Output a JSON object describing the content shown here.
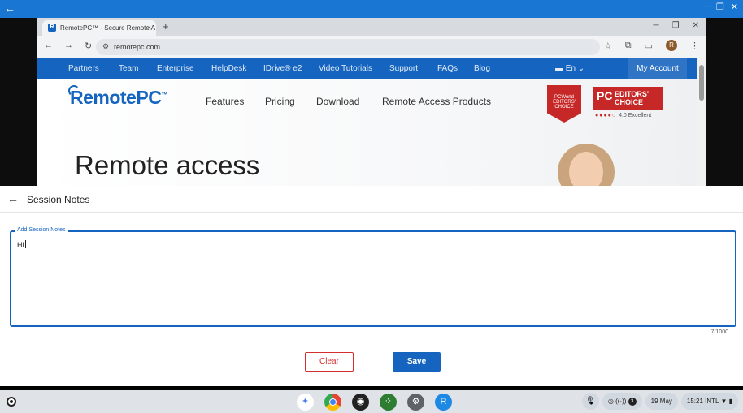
{
  "app_bar": {
    "back_icon": "arrow-left-icon",
    "window_buttons": [
      "minimize-icon",
      "restore-icon",
      "close-icon"
    ]
  },
  "browser": {
    "tab": {
      "title": "RemotePC™ - Secure Remote A",
      "close": "×"
    },
    "new_tab": "+",
    "window_controls": [
      "─",
      "❐",
      "✕"
    ],
    "url": "remotepc.com"
  },
  "site": {
    "nav": [
      "Partners",
      "Team",
      "Enterprise",
      "HelpDesk",
      "IDrive® e2",
      "Video Tutorials",
      "Support",
      "FAQs",
      "Blog"
    ],
    "language": "En",
    "account": "My Account",
    "logo": "RemotePC",
    "logo_tm": "™",
    "menu": [
      "Features",
      "Pricing",
      "Download",
      "Remote Access Products"
    ],
    "award1": "PCWorld EDITORS' CHOICE",
    "award2_pc": "PC",
    "award2_text": "EDITORS' CHOICE",
    "rating_text": "4.0 Excellent",
    "hero_text": "Remote access"
  },
  "panel": {
    "title": "Session Notes",
    "notes_label": "Add Session Notes",
    "notes_value": "Hi",
    "counter": "7/1000",
    "clear_label": "Clear",
    "save_label": "Save"
  },
  "shelf": {
    "date": "19 May",
    "time": "15:21",
    "ime": "INTL",
    "notification_count": "3"
  },
  "colors": {
    "accent": "#1565c0",
    "danger": "#d32f2f",
    "app_bar": "#1976d2"
  }
}
